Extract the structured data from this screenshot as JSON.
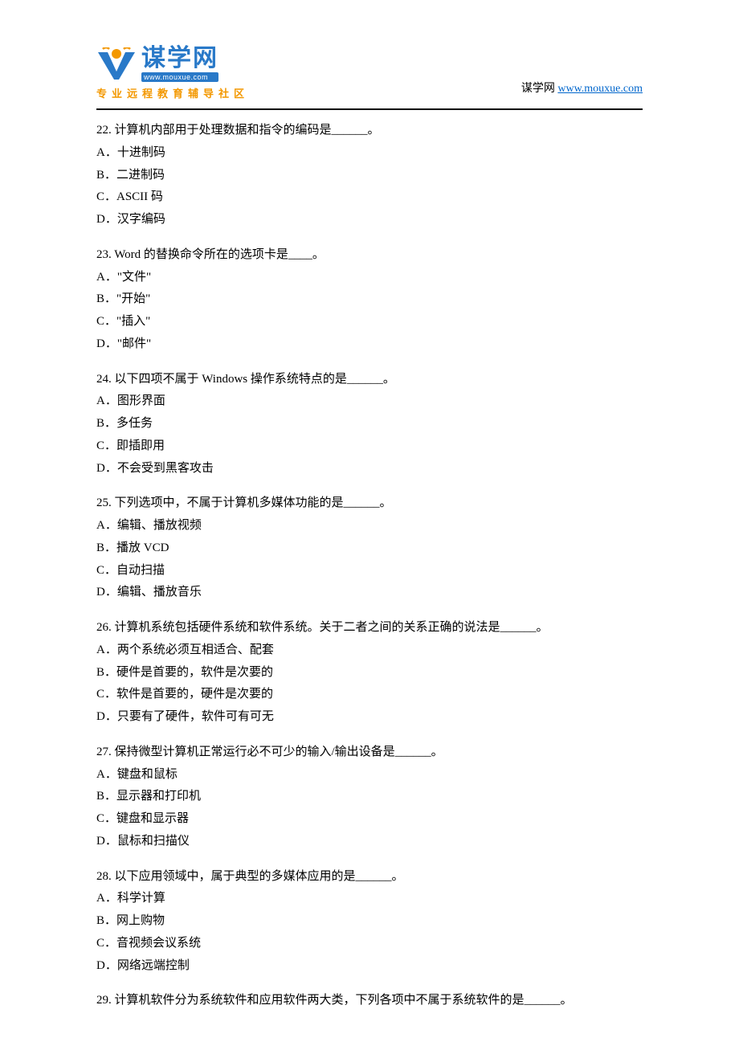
{
  "header": {
    "logo_main": "谋学网",
    "logo_sub": "www.mouxue.com",
    "logo_tagline": "专业远程教育辅导社区",
    "site_label": "谋学网 ",
    "site_url": "www.mouxue.com"
  },
  "questions": [
    {
      "num": "22.",
      "text": "  计算机内部用于处理数据和指令的编码是______。",
      "options": [
        "A．十进制码",
        "B．二进制码",
        "C．ASCII 码",
        "D．汉字编码"
      ]
    },
    {
      "num": "23.",
      "text": "  Word 的替换命令所在的选项卡是____。",
      "options": [
        "A．\"文件\"",
        "B．\"开始\"",
        "C．\"插入\"",
        "D．\"邮件\""
      ]
    },
    {
      "num": "24.",
      "text": "  以下四项不属于 Windows 操作系统特点的是______。",
      "options": [
        "A．图形界面",
        "B．多任务",
        "C．即插即用",
        "D．不会受到黑客攻击"
      ]
    },
    {
      "num": "25.",
      "text": "  下列选项中，不属于计算机多媒体功能的是______。",
      "options": [
        "A．编辑、播放视频",
        "B．播放 VCD",
        "C．自动扫描",
        "D．编辑、播放音乐"
      ]
    },
    {
      "num": "26.",
      "text": "  计算机系统包括硬件系统和软件系统。关于二者之间的关系正确的说法是______。",
      "options": [
        "A．两个系统必须互相适合、配套",
        "B．硬件是首要的，软件是次要的",
        "C．软件是首要的，硬件是次要的",
        "D．只要有了硬件，软件可有可无"
      ]
    },
    {
      "num": "27.",
      "text": "  保持微型计算机正常运行必不可少的输入/输出设备是______。",
      "options": [
        "A．键盘和鼠标",
        "B．显示器和打印机",
        "C．键盘和显示器",
        "D．鼠标和扫描仪"
      ]
    },
    {
      "num": "28.",
      "text": "  以下应用领域中，属于典型的多媒体应用的是______。",
      "options": [
        "A．科学计算",
        "B．网上购物",
        "C．音视频会议系统",
        "D．网络远端控制"
      ]
    },
    {
      "num": "29.",
      "text": "  计算机软件分为系统软件和应用软件两大类，下列各项中不属于系统软件的是______。",
      "options": []
    }
  ]
}
